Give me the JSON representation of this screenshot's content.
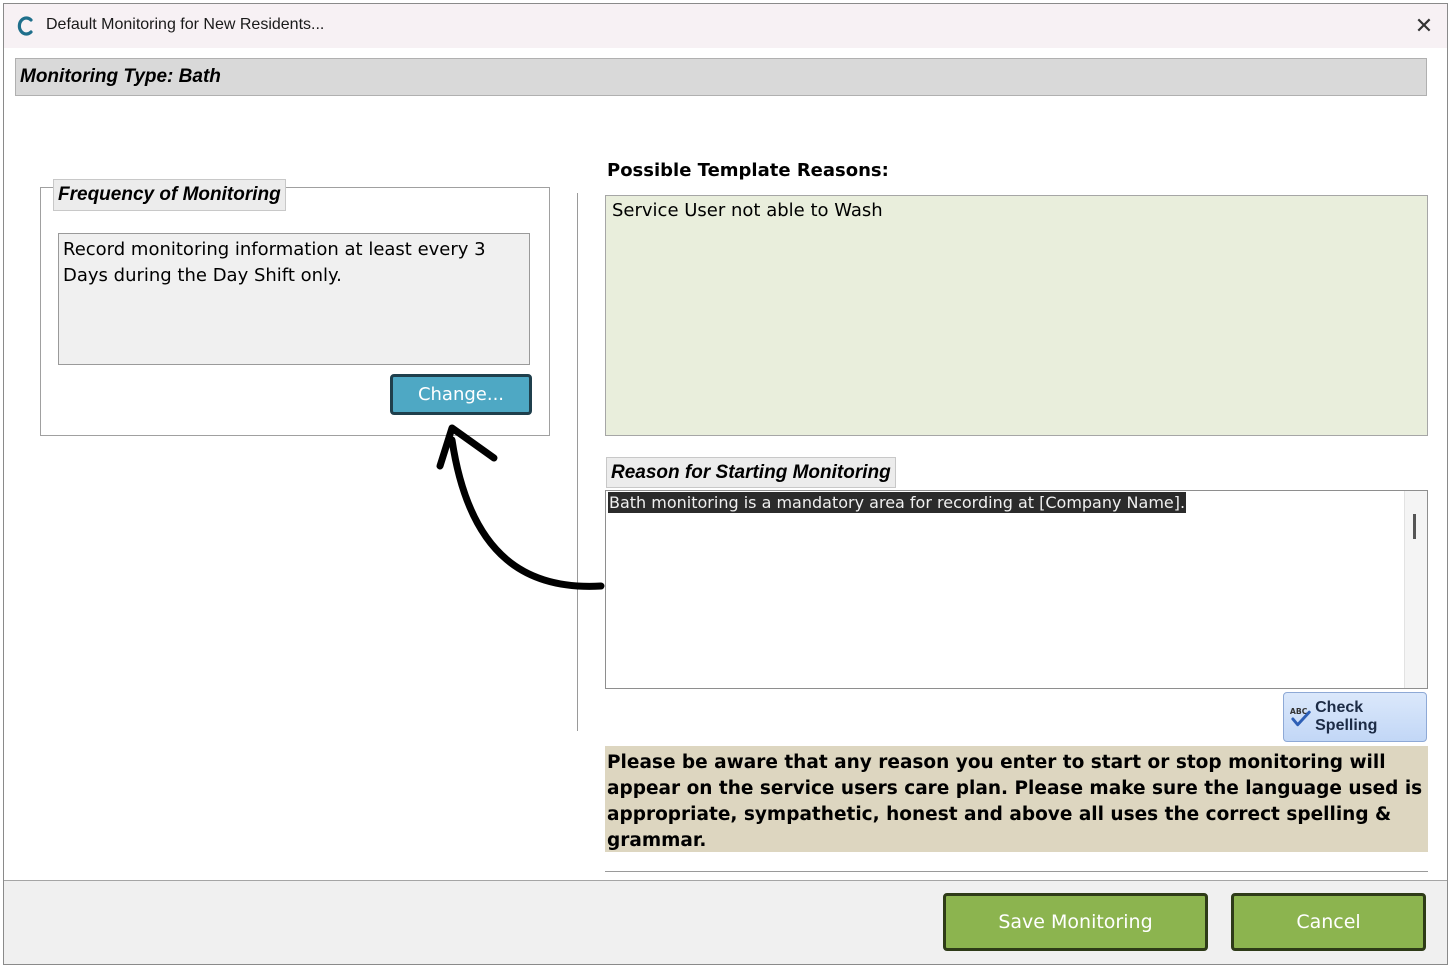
{
  "window": {
    "title": "Default Monitoring for New Residents...",
    "close_glyph": "✕"
  },
  "monitoring_type": {
    "label": "Monitoring Type: Bath"
  },
  "frequency": {
    "legend": "Frequency of Monitoring",
    "text": "Record monitoring information at least every 3 Days during the Day Shift only.",
    "change_label": "Change..."
  },
  "template_reasons": {
    "label": "Possible Template Reasons:",
    "items": [
      "Service User not able to Wash"
    ]
  },
  "reason": {
    "legend": "Reason for Starting Monitoring",
    "text": "Bath monitoring is a mandatory area for recording at [Company Name].",
    "spell_label": "Check Spelling",
    "spell_icon": "spellcheck-icon"
  },
  "notice": {
    "text": "Please be aware that any reason you enter to start or stop monitoring will appear on the service users care plan.  Please make sure the language used is appropriate, sympathetic, honest and above all uses the correct spelling & grammar."
  },
  "footer": {
    "save_label": "Save Monitoring",
    "cancel_label": "Cancel"
  },
  "colors": {
    "accent_change": "#4ea8c4",
    "button_green": "#8cb44f",
    "reasons_bg": "#e9eedc",
    "notice_bg": "#ddd6c0"
  }
}
